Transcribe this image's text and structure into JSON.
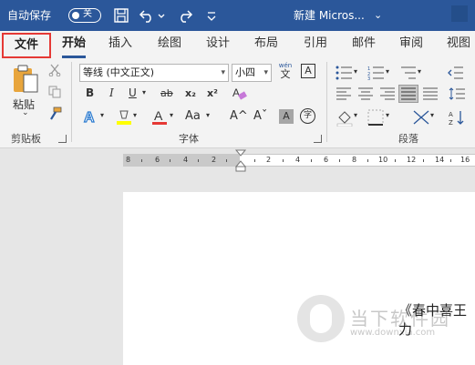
{
  "titlebar": {
    "autosave_label": "自动保存",
    "toggle_state": "关",
    "doc_title": "新建 Micros...",
    "title_dropdown": "⌄"
  },
  "tabs": [
    {
      "label": "文件"
    },
    {
      "label": "开始"
    },
    {
      "label": "插入"
    },
    {
      "label": "绘图"
    },
    {
      "label": "设计"
    },
    {
      "label": "布局"
    },
    {
      "label": "引用"
    },
    {
      "label": "邮件"
    },
    {
      "label": "审阅"
    },
    {
      "label": "视图"
    }
  ],
  "clipboard": {
    "paste_label": "粘贴",
    "group_label": "剪贴板"
  },
  "font": {
    "font_name": "等线 (中文正文)",
    "font_size": "小四",
    "wen_top": "wén",
    "wen_bottom": "文",
    "group_label": "字体",
    "bold": "B",
    "italic": "I",
    "underline": "U",
    "strike": "ab",
    "subscript": "x₂",
    "superscript": "x²",
    "grow": "A^",
    "shrink": "Aˇ",
    "case": "Aa",
    "char_border": "A",
    "char_shade": "A",
    "enclose": "字"
  },
  "paragraph": {
    "group_label": "段落"
  },
  "ruler": {
    "numbers": [
      "8",
      "6",
      "4",
      "2",
      "2",
      "4",
      "6",
      "8",
      "10",
      "12",
      "14",
      "16"
    ]
  },
  "document": {
    "visible_text": "《春中喜王力"
  },
  "watermark": {
    "title": "当下软件园",
    "url": "www.downxia.com"
  },
  "colors": {
    "accent": "#2b579a",
    "highlight_red": "#e53935"
  }
}
